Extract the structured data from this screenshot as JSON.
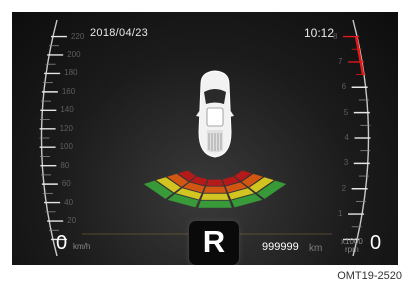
{
  "status_bar": {
    "date": "2018/04/23",
    "time": "10:12"
  },
  "speedometer": {
    "labels": [
      "220",
      "200",
      "180",
      "160",
      "140",
      "120",
      "100",
      "80",
      "60",
      "40",
      "20"
    ],
    "zero": "0",
    "unit": "km/h"
  },
  "tachometer": {
    "labels": [
      "8",
      "7",
      "6",
      "5",
      "4",
      "3",
      "2",
      "1"
    ],
    "zero": "0",
    "unit_multiplier": "x1000",
    "unit": "rpm",
    "redline_color": "#e01818"
  },
  "parking_sensor": {
    "zone_colors": [
      "#3aa33a",
      "#e0d020",
      "#e05a10",
      "#c01818"
    ]
  },
  "gear": {
    "current": "R"
  },
  "odometer": {
    "value": "999999",
    "unit": "km"
  },
  "figure_code": "OMT19-2520"
}
